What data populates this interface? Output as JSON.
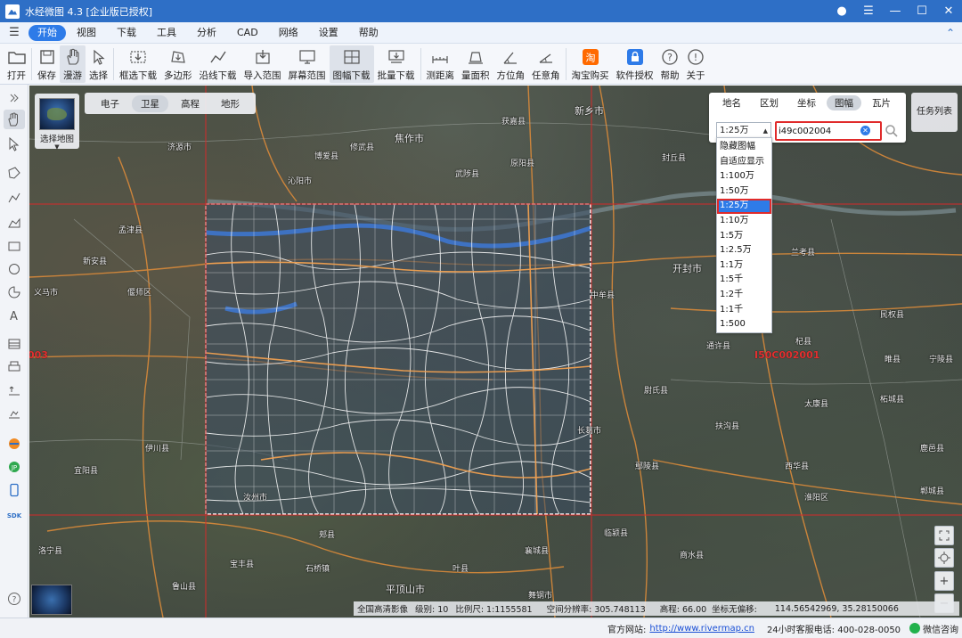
{
  "window": {
    "title": "水经微图 4.3 [企业版已授权]"
  },
  "menu": {
    "tabs": [
      "开始",
      "视图",
      "下载",
      "工具",
      "分析",
      "CAD",
      "网络",
      "设置",
      "帮助"
    ],
    "active": "开始"
  },
  "toolbar": {
    "items": [
      {
        "label": "打开",
        "icon": "folder-icon"
      },
      {
        "label": "保存",
        "icon": "save-icon"
      },
      {
        "label": "漫游",
        "icon": "hand-icon"
      },
      {
        "label": "选择",
        "icon": "pointer-icon"
      },
      {
        "label": "框选下载",
        "icon": "rect-download-icon"
      },
      {
        "label": "多边形",
        "icon": "polygon-download-icon"
      },
      {
        "label": "沿线下载",
        "icon": "line-download-icon"
      },
      {
        "label": "导入范围",
        "icon": "import-range-icon"
      },
      {
        "label": "屏幕范围",
        "icon": "screen-range-icon"
      },
      {
        "label": "图幅下载",
        "icon": "sheet-download-icon"
      },
      {
        "label": "批量下载",
        "icon": "batch-download-icon"
      },
      {
        "label": "测距离",
        "icon": "ruler-icon"
      },
      {
        "label": "量面积",
        "icon": "area-icon"
      },
      {
        "label": "方位角",
        "icon": "azimuth-icon"
      },
      {
        "label": "任意角",
        "icon": "angle-icon"
      },
      {
        "label": "淘宝购买",
        "icon": "taobao-icon"
      },
      {
        "label": "软件授权",
        "icon": "license-icon"
      },
      {
        "label": "帮助",
        "icon": "help-icon"
      },
      {
        "label": "关于",
        "icon": "about-icon"
      }
    ]
  },
  "map_switch": {
    "select_label": "选择地图",
    "types": [
      "电子",
      "卫星",
      "高程",
      "地形"
    ],
    "active": "卫星"
  },
  "search": {
    "tabs": [
      "地名",
      "区划",
      "坐标",
      "图幅",
      "瓦片"
    ],
    "active_tab": "图幅",
    "scale_value": "1:25万",
    "code_value": "i49c002004"
  },
  "task_list_label": "任务列表",
  "scale_options": [
    "隐藏图幅",
    "自适应显示",
    "1:100万",
    "1:50万",
    "1:25万",
    "1:10万",
    "1:5万",
    "1:2.5万",
    "1:1万",
    "1:5千",
    "1:2千",
    "1:1千",
    "1:500"
  ],
  "scale_selected": "1:25万",
  "sheet_labels": {
    "right": "I50C002001",
    "left": "003"
  },
  "places": {
    "jiaozuo": "焦作市",
    "xinxiang": "新乡市",
    "kaifeng": "开封市",
    "pingdingshan": "平顶山市",
    "xuchang": "许昌市",
    "huojia": "获嘉县",
    "xiuwu": "修武县",
    "wuzhi": "武陟县",
    "yuanyang": "原阳县",
    "fengqiu": "封丘县",
    "zhongmou": "中牟县",
    "weishi": "尉氏县",
    "tongxu": "通许县",
    "qixian": "杞县",
    "lankao": "兰考县",
    "minquan": "民权县",
    "taikang": "太康县",
    "fugou": "扶沟县",
    "xihua": "西华县",
    "yanling": "鄢陵县",
    "changge": "长葛市",
    "xiangcheng": "襄城县",
    "jiaxian": "郏县",
    "ruzhou": "汝州市",
    "yichuan": "伊川县",
    "yiyang": "宜阳县",
    "luoning": "洛宁县",
    "mengjin": "孟津县",
    "jiyuan": "济源市",
    "qinyang": "沁阳市",
    "boai": "博爱县",
    "yanshi": "偃师区",
    "xinan": "新安县",
    "yima": "义马市",
    "shaanxian": "陕县",
    "mengxian": "孟州市",
    "lushi": "洛宁县",
    "zhecheng": "柘城县",
    "suixian": "睢县",
    "ningling": "宁陵县",
    "shangshui": "商水县",
    "huaiyang": "淮阳区",
    "luyi": "鹿邑县",
    "dancheng": "郸城县",
    "baofeng": "宝丰县",
    "lushan": "鲁山县",
    "yexian": "叶县",
    "wugang": "舞钢市",
    "wuyang": "舞阳县",
    "lingying": "临颍县",
    "shiqiao": "石桥镇",
    "pingdingshan_label": "平顶山市"
  },
  "status_info": {
    "source": "全国高清影像",
    "level": "级别:   10",
    "scale": "比例尺:  1:1155581",
    "resolution": "空间分辨率:  305.748113",
    "elevation": "高程:     66.00",
    "coord_label": "坐标无偏移:",
    "coord": "114.56542969, 35.28150066"
  },
  "footer": {
    "site_label": "官方网站:",
    "url": "http://www.rivermap.cn",
    "hotline": "24小时客服电话:  400-028-0050",
    "wechat": "微信咨询"
  }
}
